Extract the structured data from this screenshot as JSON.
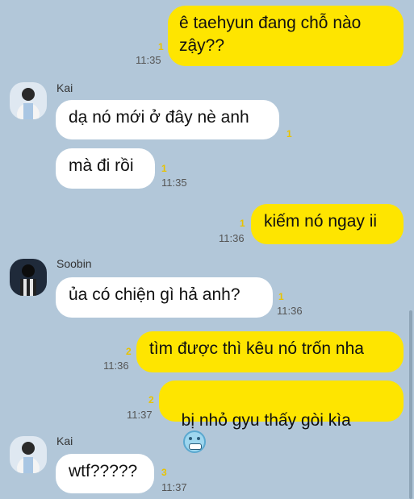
{
  "messages": [
    {
      "text": "ê taehyun đang chỗ nào\nzậy??",
      "unread": "1",
      "time": "11:35"
    },
    {
      "sender": "Kai",
      "text": "dạ nó mới ở đây nè anh",
      "unread": "1"
    },
    {
      "text": "mà đi rồi",
      "unread": "1",
      "time": "11:35"
    },
    {
      "text": "kiếm nó ngay ii",
      "unread": "1",
      "time": "11:36"
    },
    {
      "sender": "Soobin",
      "text": "ủa có chiện gì hả anh?",
      "unread": "1",
      "time": "11:36"
    },
    {
      "text": "tìm được thì kêu nó trốn nha",
      "unread": "2",
      "time": "11:36"
    },
    {
      "text": "bị nhỏ gyu thấy gòi kìa",
      "emoji": "cold-face-emoji",
      "unread": "2",
      "time": "11:37"
    },
    {
      "sender": "Kai",
      "text": "wtf?????",
      "unread": "3",
      "time": "11:37"
    }
  ],
  "colors": {
    "background": "#b2c7d9",
    "outgoing": "#fee500",
    "incoming": "#ffffff",
    "unread": "#e8c300"
  }
}
